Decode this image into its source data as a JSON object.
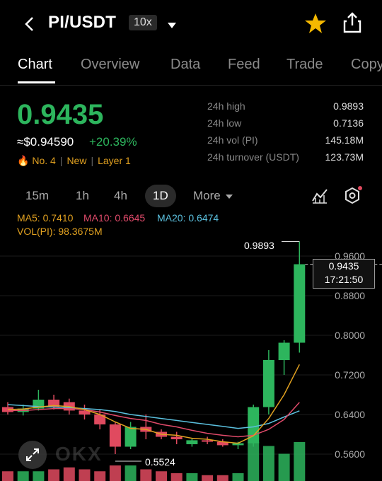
{
  "header": {
    "pair": "PI/USDT",
    "leverage": "10x"
  },
  "tabs": [
    "Chart",
    "Overview",
    "Data",
    "Feed",
    "Trade",
    "Copy"
  ],
  "ticker": {
    "price": "0.9435",
    "usd_price": "≈$0.94590",
    "change": "+20.39%",
    "rank": "No. 4",
    "tag_new": "New",
    "tag_layer": "Layer 1",
    "stats": [
      {
        "label": "24h high",
        "value": "0.9893"
      },
      {
        "label": "24h low",
        "value": "0.7136"
      },
      {
        "label": "24h vol (PI)",
        "value": "145.18M"
      },
      {
        "label": "24h turnover (USDT)",
        "value": "123.73M"
      }
    ]
  },
  "timeframes": [
    "15m",
    "1h",
    "4h",
    "1D"
  ],
  "timeframe_active": "1D",
  "more_label": "More",
  "indicators": {
    "ma5": "MA5: 0.7410",
    "ma10": "MA10: 0.6645",
    "ma20": "MA20: 0.6474",
    "vol": "VOL(PI): 98.3675M"
  },
  "colors": {
    "up": "#2db55d",
    "down": "#e04a5f",
    "ma5": "#e0a020",
    "ma10": "#e04a6a",
    "ma20": "#5bc0de"
  },
  "chart_data": {
    "type": "candlestick",
    "y_ticks": [
      "0.9600",
      "0.8800",
      "0.8000",
      "0.7200",
      "0.6400",
      "0.5600"
    ],
    "ylim": [
      0.52,
      1.0
    ],
    "current_price": "0.9435",
    "current_time": "17:21:50",
    "high_label": "0.9893",
    "low_label": "0.5524",
    "candles": [
      {
        "o": 0.655,
        "h": 0.665,
        "l": 0.64,
        "c": 0.645
      },
      {
        "o": 0.645,
        "h": 0.66,
        "l": 0.638,
        "c": 0.652
      },
      {
        "o": 0.652,
        "h": 0.69,
        "l": 0.648,
        "c": 0.67
      },
      {
        "o": 0.67,
        "h": 0.68,
        "l": 0.65,
        "c": 0.655
      },
      {
        "o": 0.665,
        "h": 0.672,
        "l": 0.64,
        "c": 0.648
      },
      {
        "o": 0.648,
        "h": 0.66,
        "l": 0.63,
        "c": 0.64
      },
      {
        "o": 0.64,
        "h": 0.65,
        "l": 0.61,
        "c": 0.62
      },
      {
        "o": 0.62,
        "h": 0.625,
        "l": 0.56,
        "c": 0.575
      },
      {
        "o": 0.575,
        "h": 0.625,
        "l": 0.57,
        "c": 0.615
      },
      {
        "o": 0.615,
        "h": 0.64,
        "l": 0.59,
        "c": 0.605
      },
      {
        "o": 0.605,
        "h": 0.61,
        "l": 0.59,
        "c": 0.595
      },
      {
        "o": 0.595,
        "h": 0.605,
        "l": 0.58,
        "c": 0.59
      },
      {
        "o": 0.58,
        "h": 0.592,
        "l": 0.575,
        "c": 0.588
      },
      {
        "o": 0.588,
        "h": 0.595,
        "l": 0.58,
        "c": 0.585
      },
      {
        "o": 0.585,
        "h": 0.59,
        "l": 0.575,
        "c": 0.578
      },
      {
        "o": 0.578,
        "h": 0.585,
        "l": 0.57,
        "c": 0.582
      },
      {
        "o": 0.582,
        "h": 0.66,
        "l": 0.575,
        "c": 0.655
      },
      {
        "o": 0.655,
        "h": 0.77,
        "l": 0.64,
        "c": 0.75
      },
      {
        "o": 0.75,
        "h": 0.79,
        "l": 0.72,
        "c": 0.785
      },
      {
        "o": 0.785,
        "h": 0.9893,
        "l": 0.765,
        "c": 0.9435
      }
    ],
    "volumes": [
      0.25,
      0.25,
      0.25,
      0.3,
      0.35,
      0.3,
      0.25,
      0.4,
      0.4,
      0.3,
      0.25,
      0.2,
      0.2,
      0.15,
      0.15,
      0.2,
      1.0,
      0.9,
      0.7,
      1.0
    ],
    "ma5": [
      0.65,
      0.651,
      0.655,
      0.658,
      0.656,
      0.65,
      0.64,
      0.625,
      0.612,
      0.61,
      0.6,
      0.598,
      0.592,
      0.59,
      0.585,
      0.582,
      0.597,
      0.632,
      0.68,
      0.741
    ],
    "ma10": [
      0.648,
      0.648,
      0.65,
      0.652,
      0.652,
      0.65,
      0.645,
      0.638,
      0.632,
      0.628,
      0.62,
      0.615,
      0.608,
      0.602,
      0.598,
      0.595,
      0.598,
      0.61,
      0.63,
      0.6645
    ],
    "ma20": [
      0.66,
      0.658,
      0.656,
      0.655,
      0.654,
      0.652,
      0.65,
      0.646,
      0.64,
      0.636,
      0.632,
      0.628,
      0.624,
      0.62,
      0.616,
      0.612,
      0.615,
      0.622,
      0.635,
      0.6474
    ]
  },
  "watermark": "OKX"
}
